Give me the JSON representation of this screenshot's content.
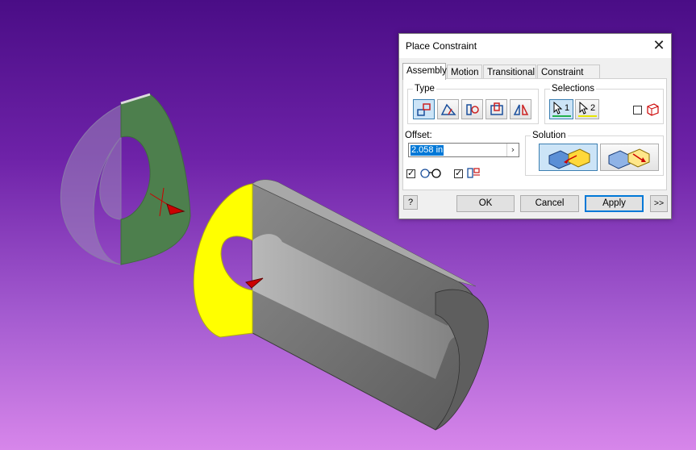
{
  "dialog": {
    "title": "Place Constraint",
    "close_glyph": "✕",
    "tabs": [
      {
        "label": "Assembly",
        "active": true
      },
      {
        "label": "Motion",
        "active": false
      },
      {
        "label": "Transitional",
        "active": false
      },
      {
        "label": "Constraint Set",
        "active": false
      }
    ],
    "type_group": {
      "label": "Type",
      "buttons": [
        {
          "icon": "mate-constraint-icon",
          "pressed": true
        },
        {
          "icon": "angle-constraint-icon",
          "pressed": false
        },
        {
          "icon": "tangent-constraint-icon",
          "pressed": false
        },
        {
          "icon": "insert-constraint-icon",
          "pressed": false
        },
        {
          "icon": "symmetry-constraint-icon",
          "pressed": false
        }
      ]
    },
    "selections_group": {
      "label": "Selections",
      "first": {
        "label": "1",
        "underline_color": "#22b14c"
      },
      "second": {
        "label": "2",
        "underline_color": "#e6e600"
      },
      "pick_part_first_checked": false
    },
    "offset": {
      "label": "Offset:",
      "value": "2.058 in",
      "arrow": "›"
    },
    "options": {
      "show_preview_checked": true,
      "predict_offset_checked": true
    },
    "solution_group": {
      "label": "Solution",
      "mate_pressed": true,
      "flush_pressed": false
    },
    "buttons": {
      "help": "?",
      "ok": "OK",
      "cancel": "Cancel",
      "apply": "Apply",
      "expand": ">>"
    }
  },
  "colors": {
    "washer_face": "#4d7f4d",
    "selected_face": "#ffff00",
    "cylinder_body": "#6f6f6f",
    "bore": "#9a9a9a",
    "arrow": "#cc0000",
    "accent": "#0078d7"
  }
}
